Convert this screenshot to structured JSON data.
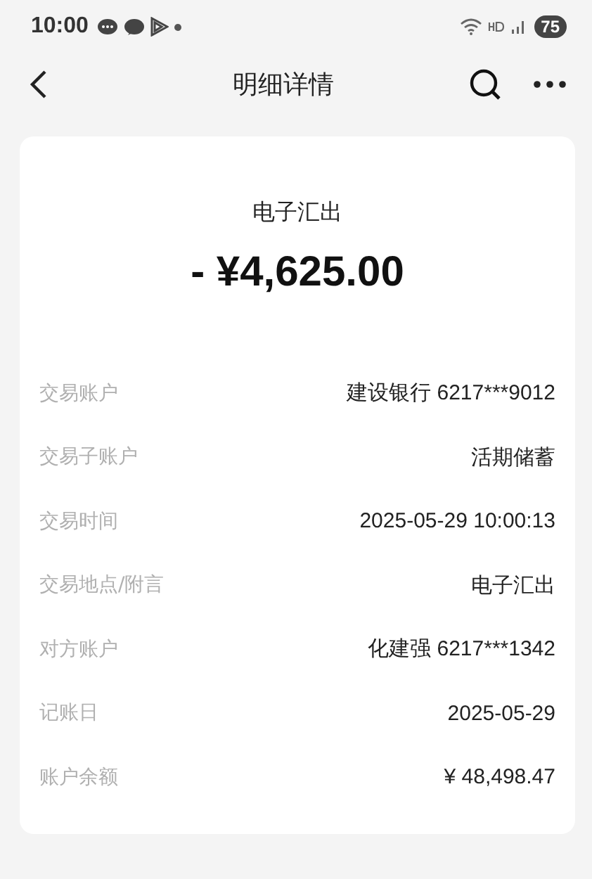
{
  "status_bar": {
    "time": "10:00",
    "battery": "75"
  },
  "nav": {
    "title": "明细详情"
  },
  "summary": {
    "type": "电子汇出",
    "amount": "- ¥4,625.00"
  },
  "details": [
    {
      "label": "交易账户",
      "value": "建设银行 6217***9012"
    },
    {
      "label": "交易子账户",
      "value": "活期储蓄"
    },
    {
      "label": "交易时间",
      "value": "2025-05-29 10:00:13"
    },
    {
      "label": "交易地点/附言",
      "value": "电子汇出"
    },
    {
      "label": "对方账户",
      "value": "化建强 6217***1342"
    },
    {
      "label": "记账日",
      "value": "2025-05-29"
    },
    {
      "label": "账户余额",
      "value": "¥ 48,498.47"
    }
  ]
}
